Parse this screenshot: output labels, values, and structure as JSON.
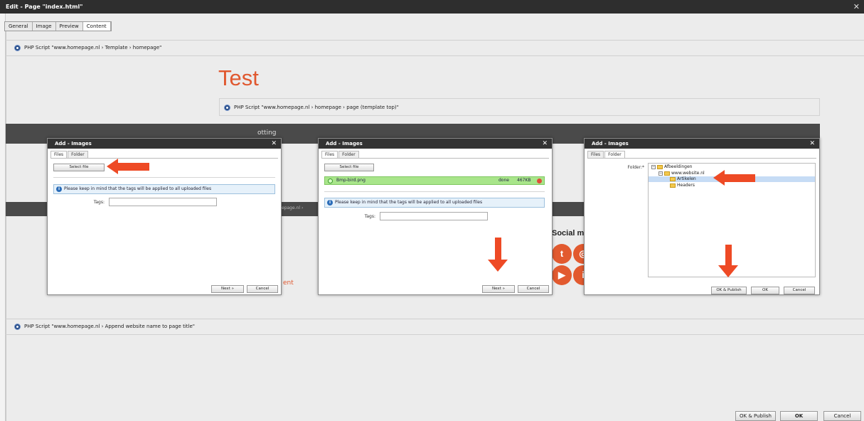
{
  "window": {
    "title": "Edit - Page \"index.html\"",
    "close": "✕"
  },
  "tabs": [
    "General",
    "Image",
    "Preview",
    "Content"
  ],
  "crumbs": {
    "top": "PHP Script \"www.homepage.nl › Template › homepage\"",
    "inner": "PHP Script \"www.homepage.nl › homepage › page (template top)\"",
    "bottom": "PHP Script \"www.homepage.nl › Append website name to page title\""
  },
  "page": {
    "title": "Test",
    "band_text": "otting",
    "band2_text": "epage.nl › ",
    "social_title": "Social me",
    "ent_text": "ent"
  },
  "dialog": {
    "title": "Add - Images",
    "tab_files": "Files",
    "tab_folder": "Folder",
    "select_file": "Select file",
    "info": "Please keep in mind that the tags will be applied to all uploaded files",
    "tags_label": "Tags:",
    "next": "Next »",
    "cancel": "Cancel",
    "folder_label": "Folder:*",
    "ok_publish": "OK & Publish",
    "ok": "OK"
  },
  "upload": {
    "filename": "Bmp-bird.png",
    "status": "done",
    "size": "467KB"
  },
  "tree": [
    "Afbeeldingen",
    "www.website.nl",
    "Artikelen",
    "Headers"
  ],
  "footer": {
    "ok_publish": "OK & Publish",
    "ok": "OK",
    "cancel": "Cancel"
  },
  "colors": {
    "accent": "#e0582f",
    "arrow": "#ee4a25"
  }
}
